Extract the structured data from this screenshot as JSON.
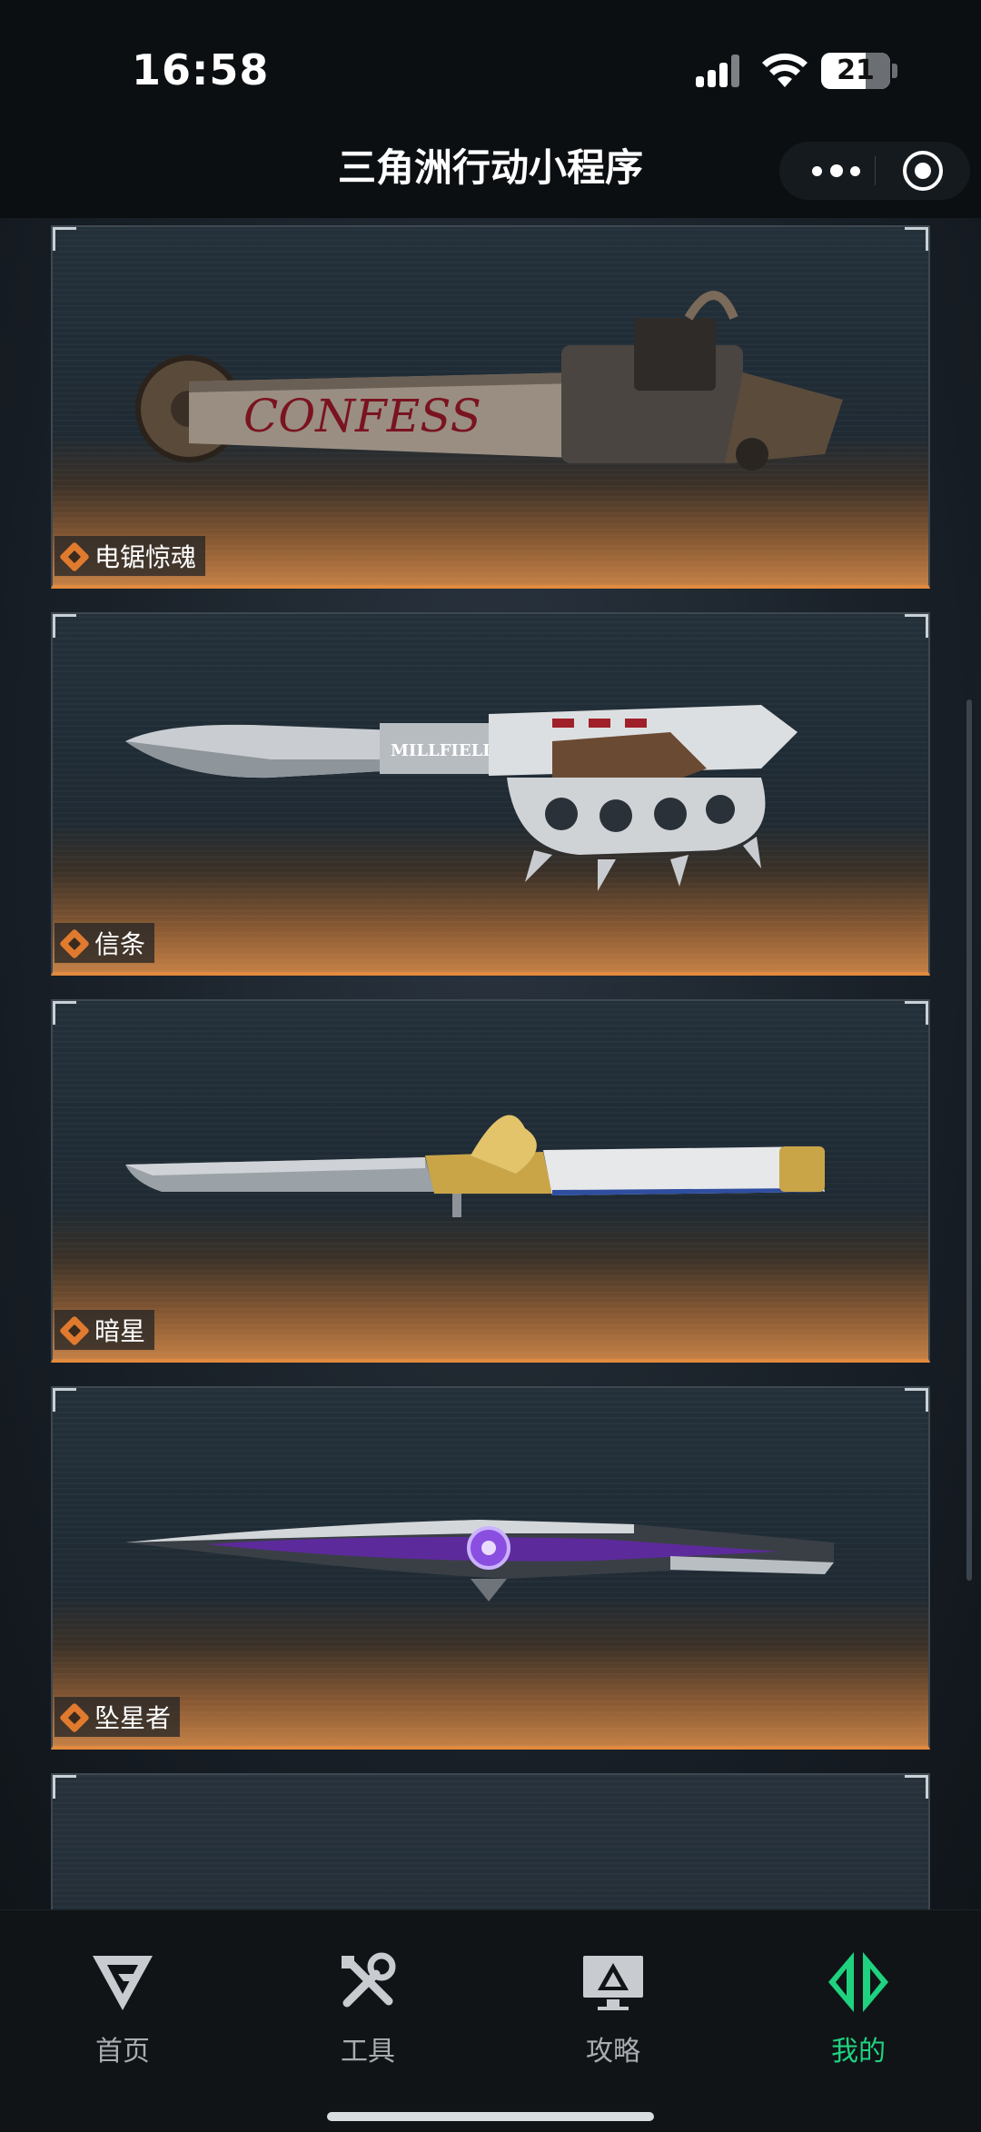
{
  "status_bar": {
    "time": "16:58",
    "battery": "21"
  },
  "header": {
    "title": "三角洲行动小程序"
  },
  "cards": [
    {
      "name": "电锯惊魂",
      "weapon": "chainsaw"
    },
    {
      "name": "信条",
      "weapon": "knuckle-knife"
    },
    {
      "name": "暗星",
      "weapon": "ornate-knife"
    },
    {
      "name": "坠星者",
      "weapon": "purple-blade"
    }
  ],
  "tabbar": {
    "items": [
      {
        "label": "首页",
        "icon": "home-logo-icon"
      },
      {
        "label": "工具",
        "icon": "tools-icon"
      },
      {
        "label": "攻略",
        "icon": "guide-monitor-icon"
      },
      {
        "label": "我的",
        "icon": "profile-logo-icon"
      }
    ],
    "active_index": 3,
    "active_color": "#1fd27f"
  },
  "colors": {
    "accent_orange": "#e28a3d",
    "background": "#0b0f12"
  }
}
